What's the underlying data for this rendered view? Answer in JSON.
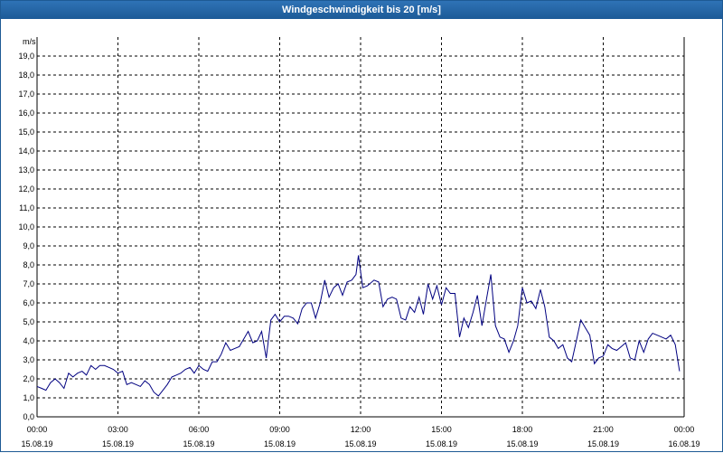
{
  "window": {
    "title": "Windgeschwindigkeit bis 20 [m/s]"
  },
  "chart_data": {
    "type": "line",
    "title": "Windgeschwindigkeit bis 20 [m/s]",
    "ylabel": "m/s",
    "xlabel": "",
    "ylim": [
      0,
      20
    ],
    "xlim_hours": [
      0,
      24
    ],
    "grid": true,
    "line_color": "#000080",
    "y_ticks": [
      "0,0",
      "1,0",
      "2,0",
      "3,0",
      "4,0",
      "5,0",
      "6,0",
      "7,0",
      "8,0",
      "9,0",
      "10,0",
      "11,0",
      "12,0",
      "13,0",
      "14,0",
      "15,0",
      "16,0",
      "17,0",
      "18,0",
      "19,0"
    ],
    "x_ticks": [
      {
        "time": "00:00",
        "date": "15.08.19"
      },
      {
        "time": "03:00",
        "date": "15.08.19"
      },
      {
        "time": "06:00",
        "date": "15.08.19"
      },
      {
        "time": "09:00",
        "date": "15.08.19"
      },
      {
        "time": "12:00",
        "date": "15.08.19"
      },
      {
        "time": "15:00",
        "date": "15.08.19"
      },
      {
        "time": "18:00",
        "date": "15.08.19"
      },
      {
        "time": "21:00",
        "date": "15.08.19"
      },
      {
        "time": "00:00",
        "date": "16.08.19"
      }
    ],
    "series": [
      {
        "values": [
          [
            0.0,
            1.6
          ],
          [
            0.17,
            1.5
          ],
          [
            0.33,
            1.4
          ],
          [
            0.5,
            1.8
          ],
          [
            0.67,
            2.0
          ],
          [
            0.83,
            1.8
          ],
          [
            1.0,
            1.5
          ],
          [
            1.17,
            2.3
          ],
          [
            1.33,
            2.1
          ],
          [
            1.5,
            2.3
          ],
          [
            1.67,
            2.4
          ],
          [
            1.83,
            2.2
          ],
          [
            2.0,
            2.7
          ],
          [
            2.17,
            2.5
          ],
          [
            2.33,
            2.7
          ],
          [
            2.5,
            2.7
          ],
          [
            2.67,
            2.6
          ],
          [
            2.83,
            2.5
          ],
          [
            3.0,
            2.3
          ],
          [
            3.17,
            2.4
          ],
          [
            3.33,
            1.7
          ],
          [
            3.5,
            1.8
          ],
          [
            3.67,
            1.7
          ],
          [
            3.83,
            1.6
          ],
          [
            4.0,
            1.9
          ],
          [
            4.17,
            1.7
          ],
          [
            4.33,
            1.3
          ],
          [
            4.5,
            1.1
          ],
          [
            4.67,
            1.4
          ],
          [
            4.83,
            1.7
          ],
          [
            5.0,
            2.1
          ],
          [
            5.17,
            2.2
          ],
          [
            5.33,
            2.3
          ],
          [
            5.5,
            2.5
          ],
          [
            5.67,
            2.6
          ],
          [
            5.83,
            2.3
          ],
          [
            6.0,
            2.7
          ],
          [
            6.17,
            2.5
          ],
          [
            6.33,
            2.4
          ],
          [
            6.5,
            2.9
          ],
          [
            6.67,
            2.9
          ],
          [
            6.83,
            3.3
          ],
          [
            7.0,
            3.9
          ],
          [
            7.17,
            3.5
          ],
          [
            7.33,
            3.6
          ],
          [
            7.5,
            3.7
          ],
          [
            7.83,
            4.5
          ],
          [
            8.0,
            3.9
          ],
          [
            8.17,
            4.0
          ],
          [
            8.33,
            4.5
          ],
          [
            8.5,
            3.1
          ],
          [
            8.67,
            5.1
          ],
          [
            8.83,
            5.4
          ],
          [
            9.0,
            5.0
          ],
          [
            9.17,
            5.3
          ],
          [
            9.33,
            5.3
          ],
          [
            9.5,
            5.2
          ],
          [
            9.67,
            4.9
          ],
          [
            9.83,
            5.7
          ],
          [
            10.0,
            6.0
          ],
          [
            10.17,
            6.0
          ],
          [
            10.33,
            5.2
          ],
          [
            10.5,
            6.0
          ],
          [
            10.67,
            7.2
          ],
          [
            10.83,
            6.3
          ],
          [
            11.0,
            6.8
          ],
          [
            11.17,
            7.0
          ],
          [
            11.33,
            6.4
          ],
          [
            11.5,
            7.1
          ],
          [
            11.67,
            7.2
          ],
          [
            11.83,
            7.5
          ],
          [
            11.92,
            8.5
          ],
          [
            12.08,
            6.8
          ],
          [
            12.25,
            6.9
          ],
          [
            12.5,
            7.2
          ],
          [
            12.67,
            7.1
          ],
          [
            12.83,
            5.8
          ],
          [
            13.0,
            6.2
          ],
          [
            13.17,
            6.3
          ],
          [
            13.33,
            6.2
          ],
          [
            13.5,
            5.2
          ],
          [
            13.67,
            5.1
          ],
          [
            13.83,
            5.8
          ],
          [
            14.0,
            5.5
          ],
          [
            14.17,
            6.3
          ],
          [
            14.33,
            5.4
          ],
          [
            14.5,
            7.0
          ],
          [
            14.67,
            6.2
          ],
          [
            14.83,
            6.9
          ],
          [
            15.0,
            5.9
          ],
          [
            15.17,
            6.8
          ],
          [
            15.33,
            6.5
          ],
          [
            15.5,
            6.5
          ],
          [
            15.67,
            4.2
          ],
          [
            15.83,
            5.2
          ],
          [
            16.0,
            4.7
          ],
          [
            16.17,
            5.5
          ],
          [
            16.33,
            6.4
          ],
          [
            16.5,
            4.8
          ],
          [
            16.67,
            6.2
          ],
          [
            16.83,
            7.5
          ],
          [
            17.0,
            4.8
          ],
          [
            17.17,
            4.2
          ],
          [
            17.33,
            4.1
          ],
          [
            17.5,
            3.4
          ],
          [
            17.67,
            4.0
          ],
          [
            17.83,
            4.8
          ],
          [
            18.0,
            6.8
          ],
          [
            18.17,
            6.0
          ],
          [
            18.33,
            6.1
          ],
          [
            18.5,
            5.7
          ],
          [
            18.67,
            6.7
          ],
          [
            18.83,
            5.8
          ],
          [
            19.0,
            4.2
          ],
          [
            19.17,
            4.0
          ],
          [
            19.33,
            3.6
          ],
          [
            19.5,
            3.8
          ],
          [
            19.67,
            3.1
          ],
          [
            19.83,
            2.9
          ],
          [
            20.0,
            4.0
          ],
          [
            20.17,
            5.1
          ],
          [
            20.33,
            4.7
          ],
          [
            20.5,
            4.3
          ],
          [
            20.67,
            2.8
          ],
          [
            20.83,
            3.1
          ],
          [
            21.0,
            3.2
          ],
          [
            21.17,
            3.8
          ],
          [
            21.33,
            3.6
          ],
          [
            21.5,
            3.5
          ],
          [
            21.67,
            3.7
          ],
          [
            21.83,
            3.9
          ],
          [
            22.0,
            3.1
          ],
          [
            22.17,
            3.0
          ],
          [
            22.33,
            4.0
          ],
          [
            22.5,
            3.4
          ],
          [
            22.67,
            4.1
          ],
          [
            22.83,
            4.4
          ],
          [
            23.0,
            4.3
          ],
          [
            23.17,
            4.2
          ],
          [
            23.33,
            4.1
          ],
          [
            23.5,
            4.3
          ],
          [
            23.67,
            3.8
          ],
          [
            23.83,
            2.4
          ]
        ]
      }
    ]
  }
}
